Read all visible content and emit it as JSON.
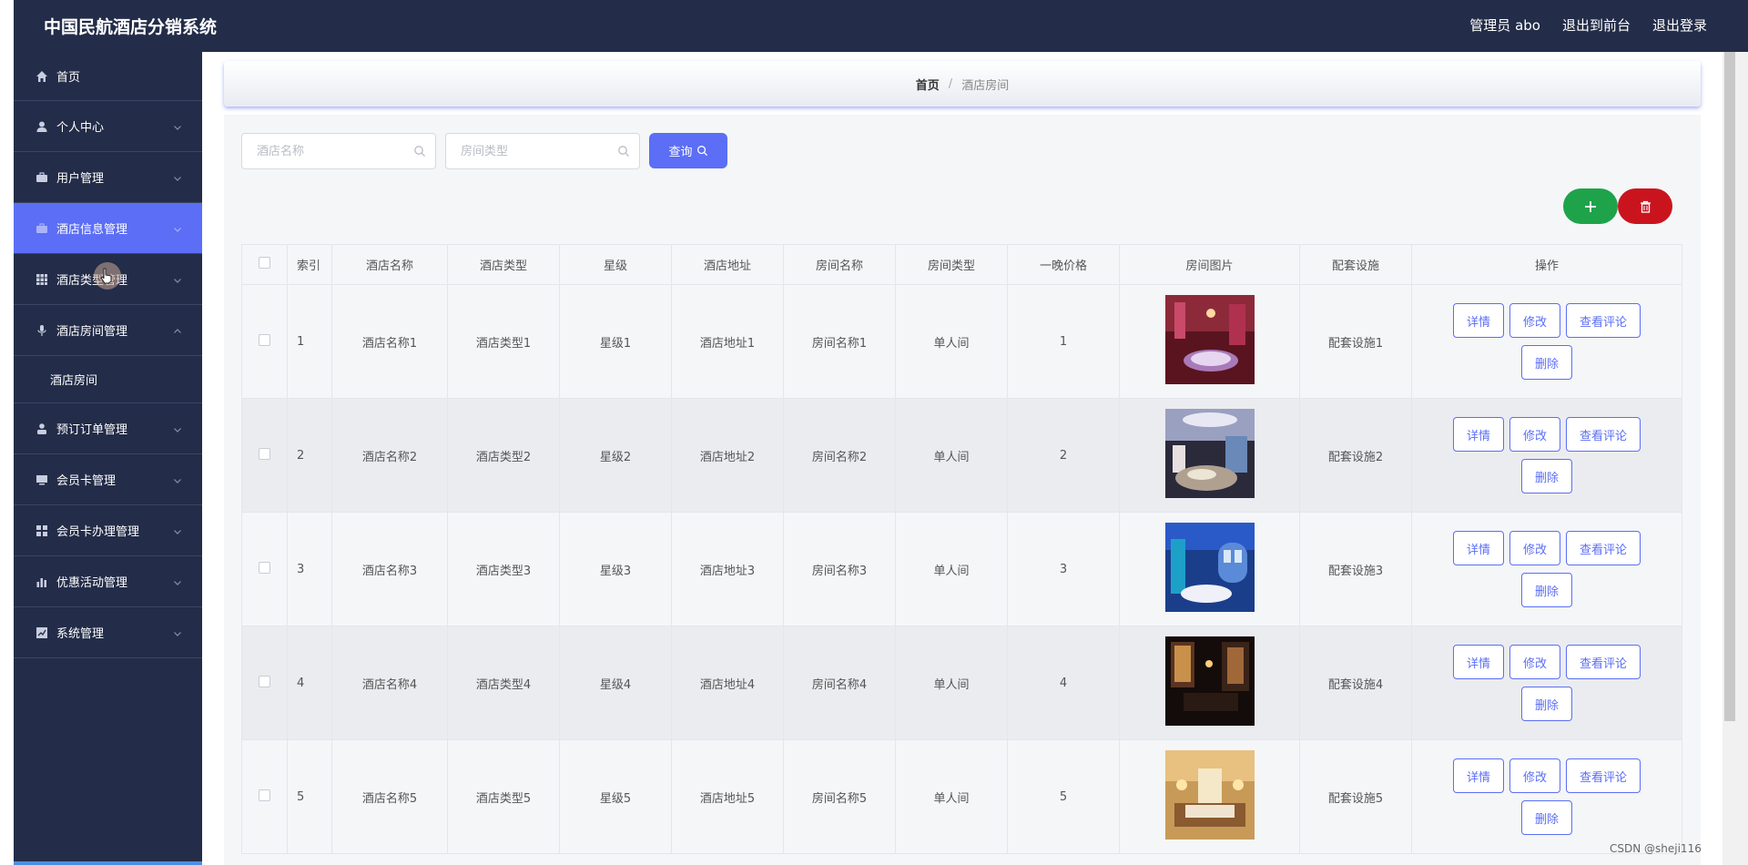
{
  "app": {
    "title": "中国民航酒店分销系统"
  },
  "topbar": {
    "admin_label": "管理员 abo",
    "back_label": "退出到前台",
    "logout_label": "退出登录"
  },
  "sidebar": {
    "items": [
      {
        "label": "首页",
        "icon": "home-icon"
      },
      {
        "label": "个人中心",
        "icon": "user-icon"
      },
      {
        "label": "用户管理",
        "icon": "briefcase-icon"
      },
      {
        "label": "酒店信息管理",
        "icon": "suitcase-icon",
        "active": true
      },
      {
        "label": "酒店类型管理",
        "icon": "grid-icon"
      },
      {
        "label": "酒店房间管理",
        "icon": "mic-icon",
        "expanded": true
      },
      {
        "label": "预订订单管理",
        "icon": "person-icon"
      },
      {
        "label": "会员卡管理",
        "icon": "monitor-icon"
      },
      {
        "label": "会员卡办理管理",
        "icon": "apps-icon"
      },
      {
        "label": "优惠活动管理",
        "icon": "bar-chart-icon"
      },
      {
        "label": "系统管理",
        "icon": "chart-icon"
      }
    ],
    "submenu": {
      "label": "酒店房间"
    }
  },
  "breadcrumb": {
    "home": "首页",
    "separator": "/",
    "current": "酒店房间"
  },
  "search": {
    "hotel_name_placeholder": "酒店名称",
    "room_type_placeholder": "房间类型",
    "query_label": "查询"
  },
  "table": {
    "headers": [
      "索引",
      "酒店名称",
      "酒店类型",
      "星级",
      "酒店地址",
      "房间名称",
      "房间类型",
      "一晚价格",
      "房间图片",
      "配套设施",
      "操作"
    ],
    "rows": [
      {
        "index": "1",
        "hotel_name": "酒店名称1",
        "hotel_type": "酒店类型1",
        "star": "星级1",
        "address": "酒店地址1",
        "room_name": "房间名称1",
        "room_type": "单人间",
        "price": "1",
        "facility": "配套设施1"
      },
      {
        "index": "2",
        "hotel_name": "酒店名称2",
        "hotel_type": "酒店类型2",
        "star": "星级2",
        "address": "酒店地址2",
        "room_name": "房间名称2",
        "room_type": "单人间",
        "price": "2",
        "facility": "配套设施2"
      },
      {
        "index": "3",
        "hotel_name": "酒店名称3",
        "hotel_type": "酒店类型3",
        "star": "星级3",
        "address": "酒店地址3",
        "room_name": "房间名称3",
        "room_type": "单人间",
        "price": "3",
        "facility": "配套设施3"
      },
      {
        "index": "4",
        "hotel_name": "酒店名称4",
        "hotel_type": "酒店类型4",
        "star": "星级4",
        "address": "酒店地址4",
        "room_name": "房间名称4",
        "room_type": "单人间",
        "price": "4",
        "facility": "配套设施4"
      },
      {
        "index": "5",
        "hotel_name": "酒店名称5",
        "hotel_type": "酒店类型5",
        "star": "星级5",
        "address": "酒店地址5",
        "room_name": "房间名称5",
        "room_type": "单人间",
        "price": "5",
        "facility": "配套设施5"
      }
    ],
    "actions": {
      "detail": "详情",
      "edit": "修改",
      "reviews": "查看评论",
      "delete": "删除"
    }
  },
  "watermark": "CSDN @sheji116",
  "colors": {
    "topbar": "#232c48",
    "accent": "#5b6ef5",
    "add": "#1ea34a",
    "delete": "#c9141e"
  }
}
